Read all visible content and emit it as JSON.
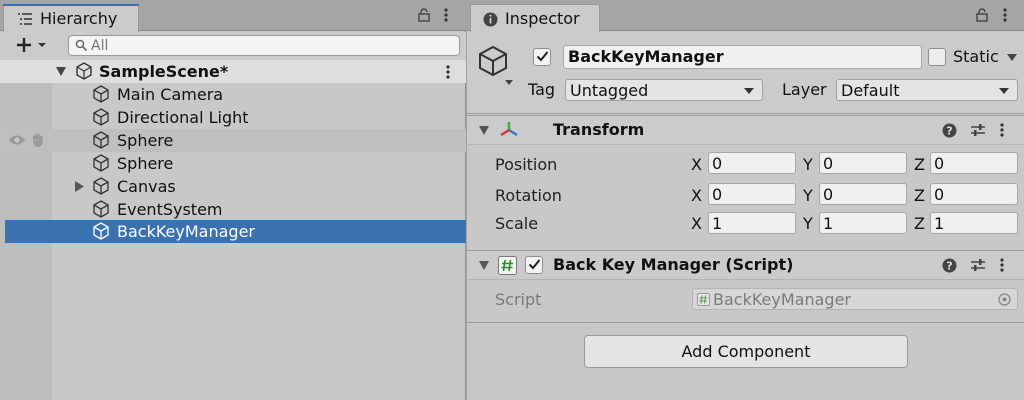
{
  "hierarchy": {
    "tab_label": "Hierarchy",
    "search": {
      "placeholder": "All"
    },
    "scene": {
      "name": "SampleScene*"
    },
    "items": [
      {
        "label": "Main Camera"
      },
      {
        "label": "Directional Light"
      },
      {
        "label": "Sphere"
      },
      {
        "label": "Sphere"
      },
      {
        "label": "Canvas"
      },
      {
        "label": "EventSystem"
      },
      {
        "label": "BackKeyManager"
      }
    ]
  },
  "inspector": {
    "tab_label": "Inspector",
    "gameobject": {
      "name": "BackKeyManager",
      "active": true,
      "static_label": "Static",
      "tag_label": "Tag",
      "tag_value": "Untagged",
      "layer_label": "Layer",
      "layer_value": "Default"
    },
    "transform": {
      "title": "Transform",
      "rows": [
        {
          "label": "Position",
          "x": "0",
          "y": "0",
          "z": "0"
        },
        {
          "label": "Rotation",
          "x": "0",
          "y": "0",
          "z": "0"
        },
        {
          "label": "Scale",
          "x": "1",
          "y": "1",
          "z": "1"
        }
      ],
      "axes": {
        "x": "X",
        "y": "Y",
        "z": "Z"
      }
    },
    "script_component": {
      "title": "Back Key Manager (Script)",
      "enabled": true,
      "script_label": "Script",
      "script_value": "BackKeyManager"
    },
    "add_component_label": "Add Component"
  },
  "colors": {
    "selection": "#3a72b0",
    "panel_bg": "#c8c8c8",
    "tabbar_bg": "#a5a5a5"
  }
}
